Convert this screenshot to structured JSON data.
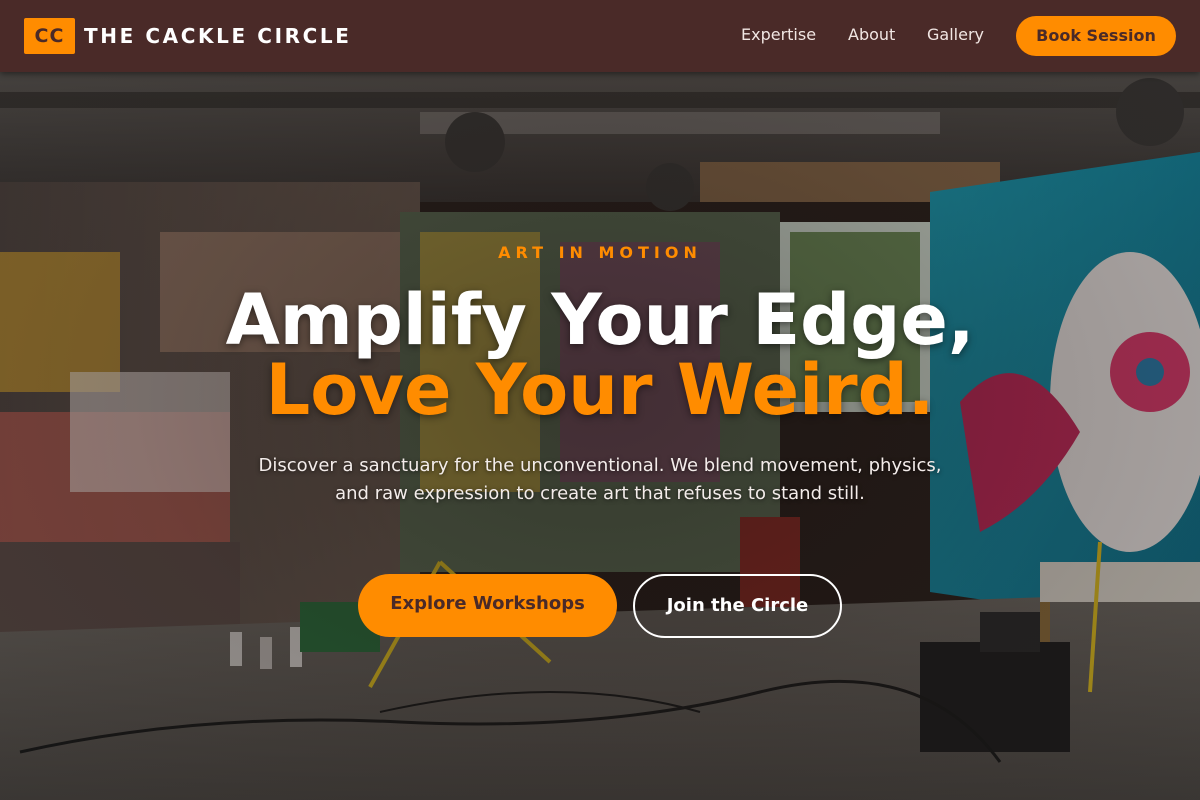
{
  "header": {
    "logo_text": "CC",
    "brand_name": "THE CACKLE CIRCLE",
    "nav": [
      {
        "label": "Expertise"
      },
      {
        "label": "About"
      },
      {
        "label": "Gallery"
      }
    ],
    "cta_label": "Book Session"
  },
  "hero": {
    "background": "graffiti-art-studio-photo",
    "eyebrow": "ART IN MOTION",
    "headline_line1": "Amplify Your Edge,",
    "headline_line2": "Love Your Weird.",
    "description": "Discover a sanctuary for the unconventional. We blend movement, physics, and raw expression to create art that refuses to stand still.",
    "primary_button": "Explore Workshops",
    "secondary_button": "Join the Circle"
  },
  "colors": {
    "header_bg": "#4a2a28",
    "accent": "#ff8c00",
    "text_light": "#ffffff"
  }
}
